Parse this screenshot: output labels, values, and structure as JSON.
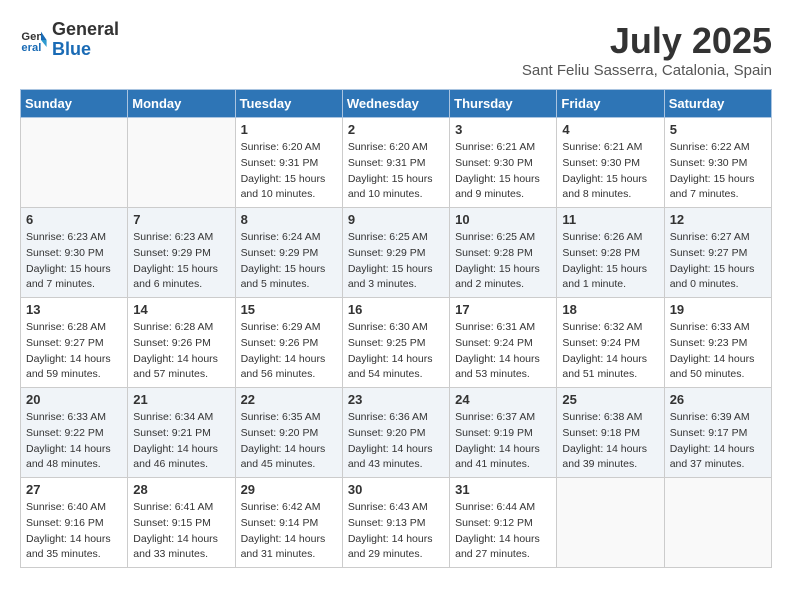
{
  "header": {
    "logo_text_general": "General",
    "logo_text_blue": "Blue",
    "month_year": "July 2025",
    "location": "Sant Feliu Sasserra, Catalonia, Spain"
  },
  "weekdays": [
    "Sunday",
    "Monday",
    "Tuesday",
    "Wednesday",
    "Thursday",
    "Friday",
    "Saturday"
  ],
  "weeks": [
    [
      {
        "day": "",
        "info": ""
      },
      {
        "day": "",
        "info": ""
      },
      {
        "day": "1",
        "info": "Sunrise: 6:20 AM\nSunset: 9:31 PM\nDaylight: 15 hours and 10 minutes."
      },
      {
        "day": "2",
        "info": "Sunrise: 6:20 AM\nSunset: 9:31 PM\nDaylight: 15 hours and 10 minutes."
      },
      {
        "day": "3",
        "info": "Sunrise: 6:21 AM\nSunset: 9:30 PM\nDaylight: 15 hours and 9 minutes."
      },
      {
        "day": "4",
        "info": "Sunrise: 6:21 AM\nSunset: 9:30 PM\nDaylight: 15 hours and 8 minutes."
      },
      {
        "day": "5",
        "info": "Sunrise: 6:22 AM\nSunset: 9:30 PM\nDaylight: 15 hours and 7 minutes."
      }
    ],
    [
      {
        "day": "6",
        "info": "Sunrise: 6:23 AM\nSunset: 9:30 PM\nDaylight: 15 hours and 7 minutes."
      },
      {
        "day": "7",
        "info": "Sunrise: 6:23 AM\nSunset: 9:29 PM\nDaylight: 15 hours and 6 minutes."
      },
      {
        "day": "8",
        "info": "Sunrise: 6:24 AM\nSunset: 9:29 PM\nDaylight: 15 hours and 5 minutes."
      },
      {
        "day": "9",
        "info": "Sunrise: 6:25 AM\nSunset: 9:29 PM\nDaylight: 15 hours and 3 minutes."
      },
      {
        "day": "10",
        "info": "Sunrise: 6:25 AM\nSunset: 9:28 PM\nDaylight: 15 hours and 2 minutes."
      },
      {
        "day": "11",
        "info": "Sunrise: 6:26 AM\nSunset: 9:28 PM\nDaylight: 15 hours and 1 minute."
      },
      {
        "day": "12",
        "info": "Sunrise: 6:27 AM\nSunset: 9:27 PM\nDaylight: 15 hours and 0 minutes."
      }
    ],
    [
      {
        "day": "13",
        "info": "Sunrise: 6:28 AM\nSunset: 9:27 PM\nDaylight: 14 hours and 59 minutes."
      },
      {
        "day": "14",
        "info": "Sunrise: 6:28 AM\nSunset: 9:26 PM\nDaylight: 14 hours and 57 minutes."
      },
      {
        "day": "15",
        "info": "Sunrise: 6:29 AM\nSunset: 9:26 PM\nDaylight: 14 hours and 56 minutes."
      },
      {
        "day": "16",
        "info": "Sunrise: 6:30 AM\nSunset: 9:25 PM\nDaylight: 14 hours and 54 minutes."
      },
      {
        "day": "17",
        "info": "Sunrise: 6:31 AM\nSunset: 9:24 PM\nDaylight: 14 hours and 53 minutes."
      },
      {
        "day": "18",
        "info": "Sunrise: 6:32 AM\nSunset: 9:24 PM\nDaylight: 14 hours and 51 minutes."
      },
      {
        "day": "19",
        "info": "Sunrise: 6:33 AM\nSunset: 9:23 PM\nDaylight: 14 hours and 50 minutes."
      }
    ],
    [
      {
        "day": "20",
        "info": "Sunrise: 6:33 AM\nSunset: 9:22 PM\nDaylight: 14 hours and 48 minutes."
      },
      {
        "day": "21",
        "info": "Sunrise: 6:34 AM\nSunset: 9:21 PM\nDaylight: 14 hours and 46 minutes."
      },
      {
        "day": "22",
        "info": "Sunrise: 6:35 AM\nSunset: 9:20 PM\nDaylight: 14 hours and 45 minutes."
      },
      {
        "day": "23",
        "info": "Sunrise: 6:36 AM\nSunset: 9:20 PM\nDaylight: 14 hours and 43 minutes."
      },
      {
        "day": "24",
        "info": "Sunrise: 6:37 AM\nSunset: 9:19 PM\nDaylight: 14 hours and 41 minutes."
      },
      {
        "day": "25",
        "info": "Sunrise: 6:38 AM\nSunset: 9:18 PM\nDaylight: 14 hours and 39 minutes."
      },
      {
        "day": "26",
        "info": "Sunrise: 6:39 AM\nSunset: 9:17 PM\nDaylight: 14 hours and 37 minutes."
      }
    ],
    [
      {
        "day": "27",
        "info": "Sunrise: 6:40 AM\nSunset: 9:16 PM\nDaylight: 14 hours and 35 minutes."
      },
      {
        "day": "28",
        "info": "Sunrise: 6:41 AM\nSunset: 9:15 PM\nDaylight: 14 hours and 33 minutes."
      },
      {
        "day": "29",
        "info": "Sunrise: 6:42 AM\nSunset: 9:14 PM\nDaylight: 14 hours and 31 minutes."
      },
      {
        "day": "30",
        "info": "Sunrise: 6:43 AM\nSunset: 9:13 PM\nDaylight: 14 hours and 29 minutes."
      },
      {
        "day": "31",
        "info": "Sunrise: 6:44 AM\nSunset: 9:12 PM\nDaylight: 14 hours and 27 minutes."
      },
      {
        "day": "",
        "info": ""
      },
      {
        "day": "",
        "info": ""
      }
    ]
  ]
}
